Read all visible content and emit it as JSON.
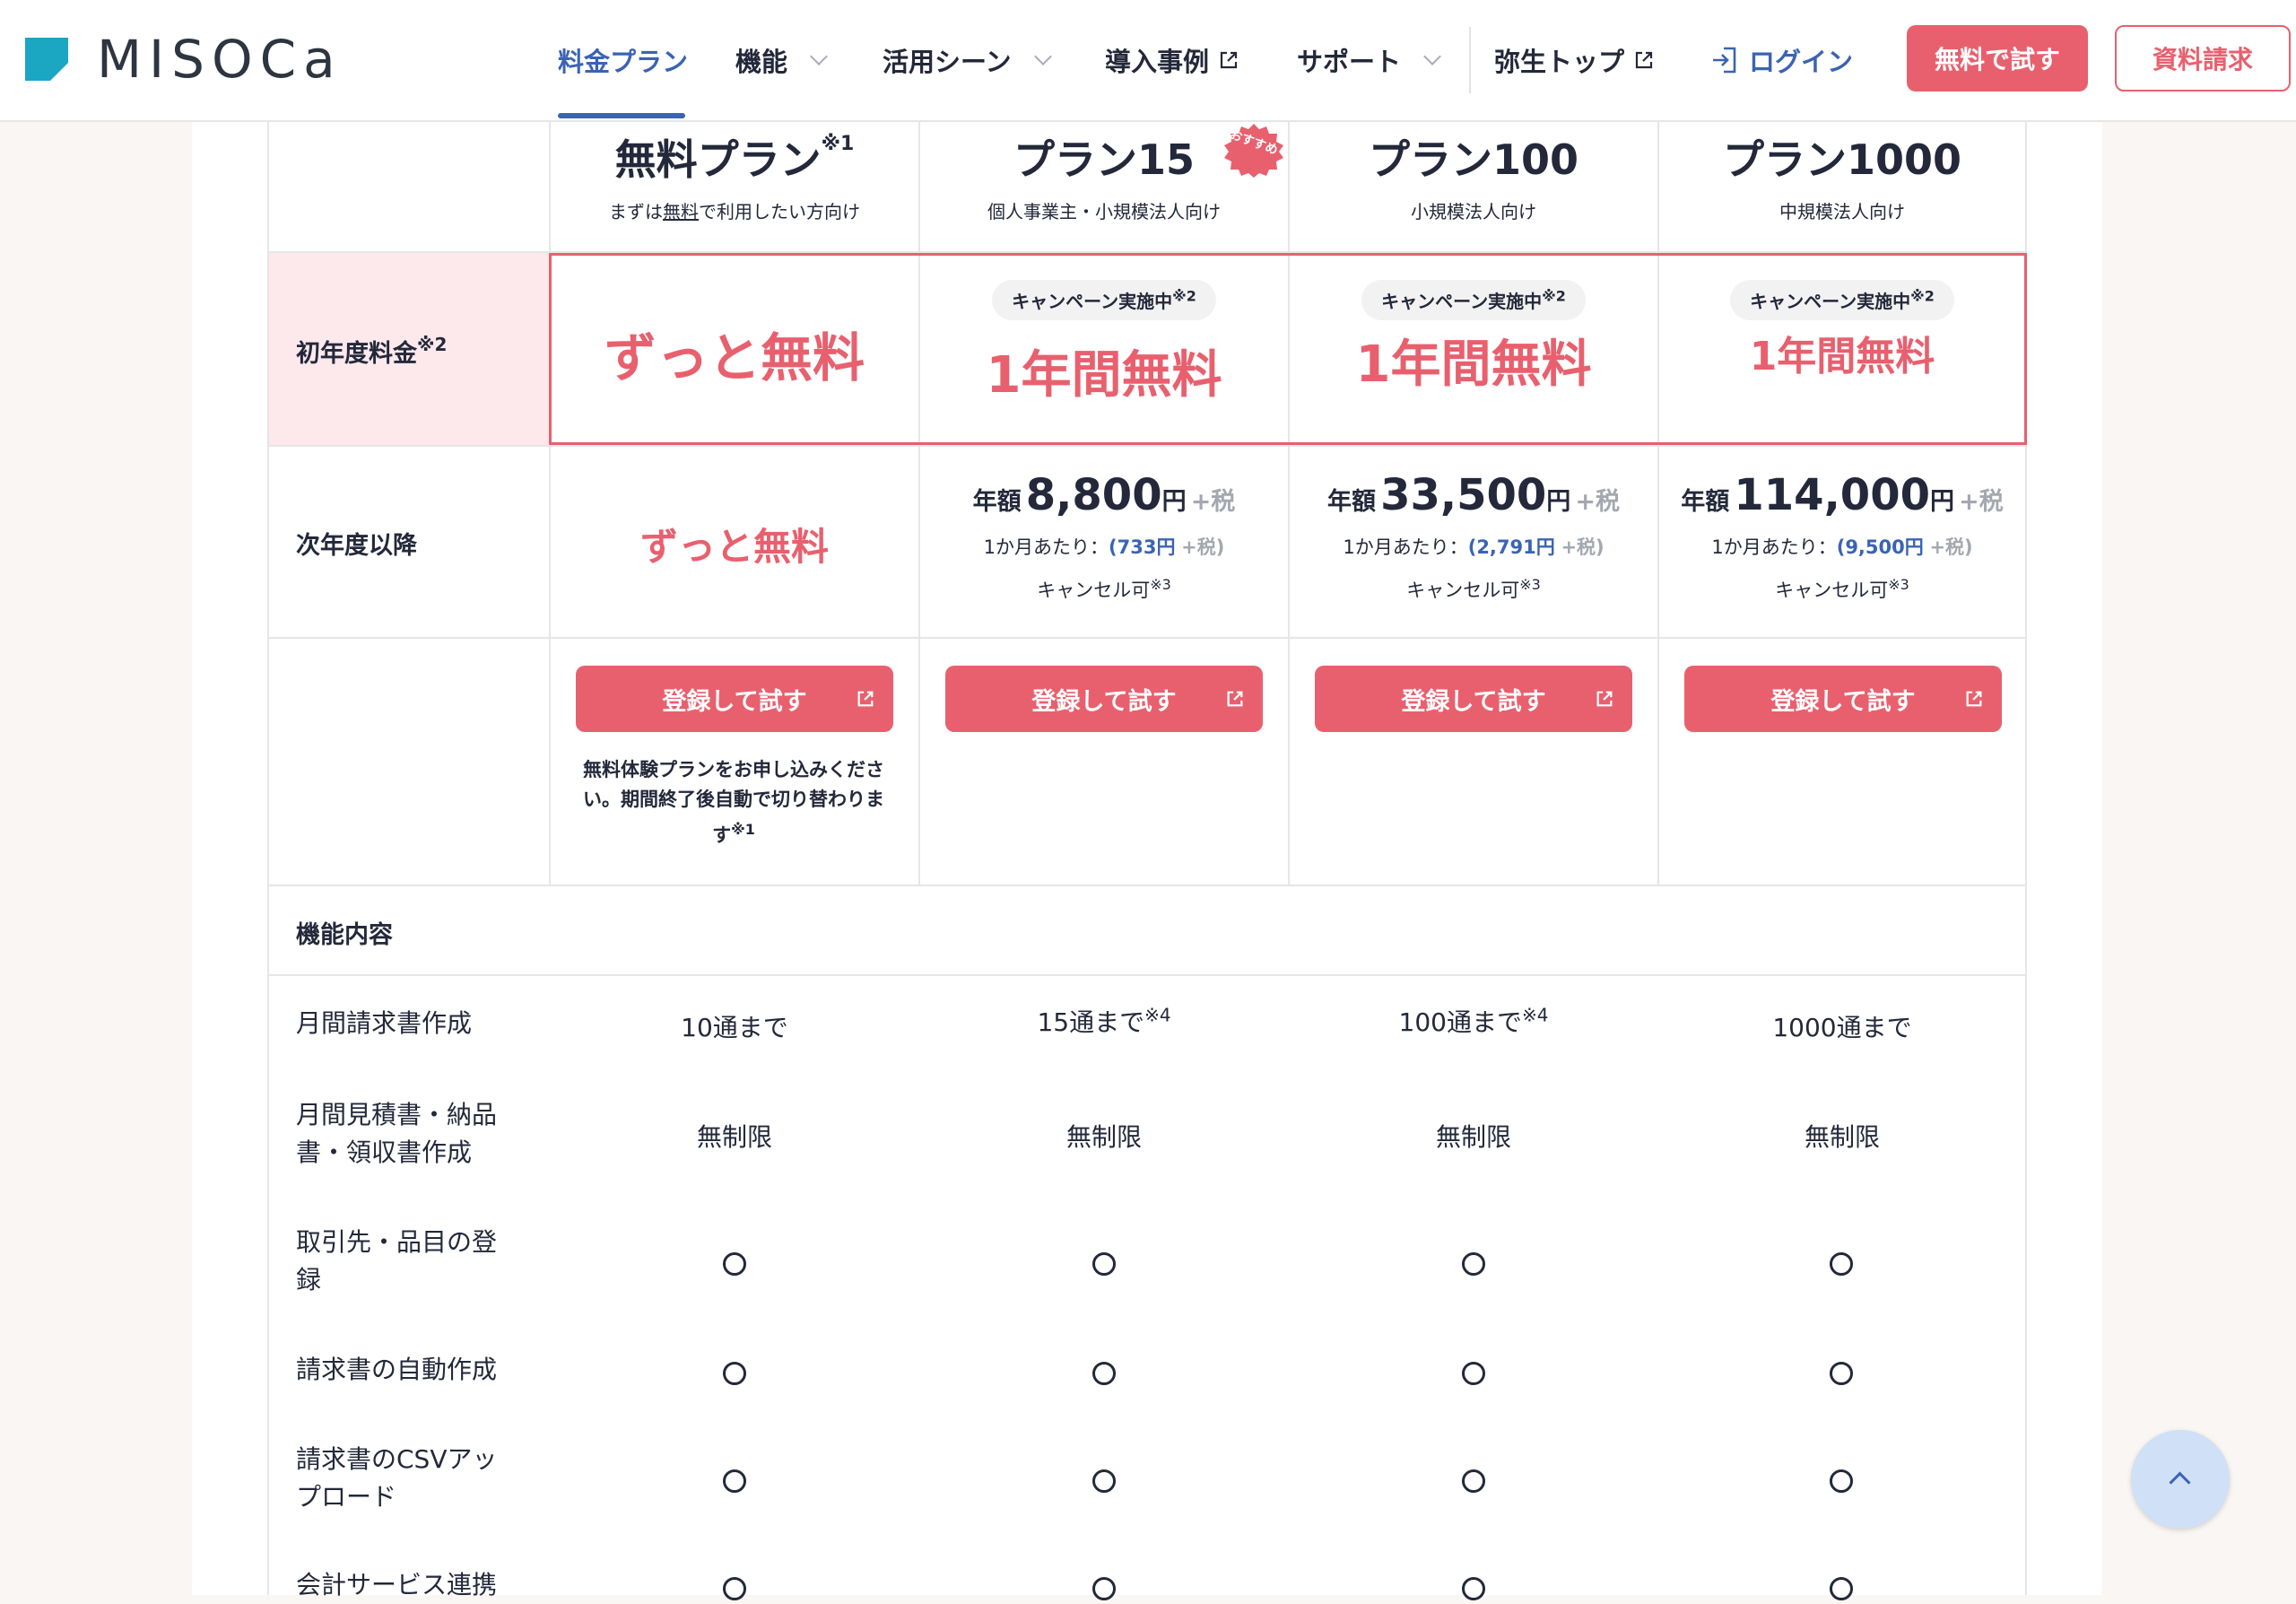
{
  "header": {
    "logo_text": "MISOCa",
    "nav": {
      "pricing": "料金プラン",
      "features": "機能",
      "scenes": "活用シーン",
      "cases": "導入事例",
      "support": "サポート",
      "yayoi": "弥生トップ",
      "login": "ログイン"
    },
    "btn_trial": "無料で試す",
    "btn_doc": "資料請求"
  },
  "plans": [
    {
      "name": "無料プラン",
      "sup": "※1",
      "sub_pre": "まずは",
      "sub_u": "無料",
      "sub_post": "で利用したい方向け"
    },
    {
      "name": "プラン15",
      "sub": "個人事業主・小規模法人向け",
      "badge": "おすすめ"
    },
    {
      "name": "プラン100",
      "sub": "小規模法人向け"
    },
    {
      "name": "プラン1000",
      "sub": "中規模法人向け"
    }
  ],
  "first_year": {
    "label": "初年度料金",
    "label_sup": "※2",
    "free_text": "ずっと無料",
    "campaign": "キャンペーン実施中",
    "campaign_sup": "※2",
    "year_free": "1年間無料"
  },
  "next_year": {
    "label": "次年度以降",
    "free_text": "ずっと無料",
    "annual_label": "年額",
    "yen": "円",
    "tax": "+税",
    "monthly_label": "1か月あたり：",
    "cancel": "キャンセル可",
    "cancel_sup": "※3",
    "prices": [
      {
        "annual": "8,800",
        "monthly": "(733円",
        "monthly_tax": "+税)"
      },
      {
        "annual": "33,500",
        "monthly": "(2,791円",
        "monthly_tax": "+税)"
      },
      {
        "annual": "114,000",
        "monthly": "(9,500円",
        "monthly_tax": "+税)"
      }
    ]
  },
  "register_btn": "登録して試す",
  "free_note": "無料体験プランをお申し込みください。期間終了後自動で切り替わります",
  "free_note_sup": "※1",
  "features_header": "機能内容",
  "features": [
    {
      "label": "月間請求書作成",
      "values": [
        "10通まで",
        "15通まで",
        "100通まで",
        "1000通まで"
      ],
      "sups": [
        "",
        "※4",
        "※4",
        ""
      ]
    },
    {
      "label": "月間見積書・納品書・領収書作成",
      "values": [
        "無制限",
        "無制限",
        "無制限",
        "無制限"
      ]
    },
    {
      "label": "取引先・品目の登録",
      "values": [
        "○",
        "○",
        "○",
        "○"
      ]
    },
    {
      "label": "請求書の自動作成",
      "values": [
        "○",
        "○",
        "○",
        "○"
      ]
    },
    {
      "label": "請求書のCSVアップロード",
      "values": [
        "○",
        "○",
        "○",
        "○"
      ]
    },
    {
      "label": "会計サービス連携",
      "values": [
        "○",
        "○",
        "○",
        "○"
      ]
    }
  ],
  "colors": {
    "accent": "#e8606e",
    "brand_blue": "#3a63b5",
    "logo_teal": "#1ba6c2"
  }
}
